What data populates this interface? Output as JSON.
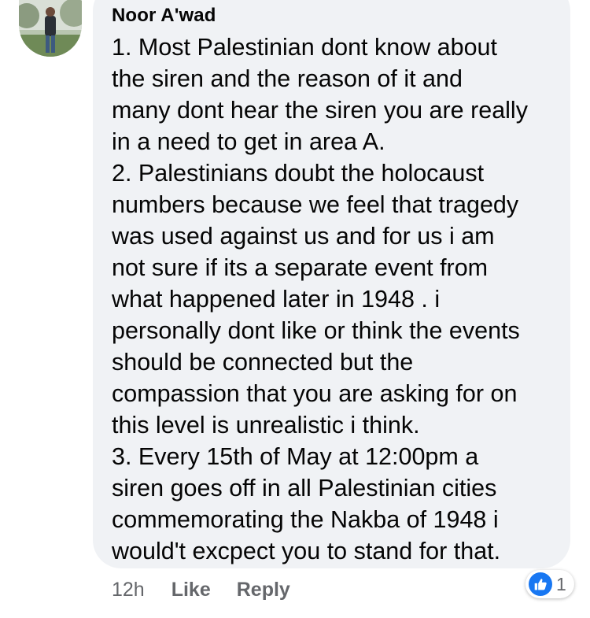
{
  "comment": {
    "author": "Noor A'wad",
    "lines": [
      "1. Most Palestinian dont know about",
      "the siren and the reason of it and",
      "many dont hear the siren you are really",
      "in a need to get in area A.",
      "2. Palestinians doubt the holocaust",
      "numbers because we feel that tragedy",
      "was used against us and for us i am",
      "not sure if its a separate event from",
      "what happened later in 1948 . i",
      "personally dont like or think the events",
      "should be connected but the",
      "compassion that you are asking for on",
      "this level is unrealistic i think.",
      "3. Every 15th of May at 12:00pm a",
      "siren goes off in all Palestinian cities",
      "commemorating the Nakba of 1948 i",
      "would't excpect you to stand for that."
    ]
  },
  "actions": {
    "timestamp": "12h",
    "like_label": "Like",
    "reply_label": "Reply"
  },
  "reactions": {
    "icon": "thumbs-up-icon",
    "count": "1",
    "color": "#1877f2"
  },
  "colors": {
    "bubble": "#f0f2f5",
    "text": "#050505",
    "secondary": "#65676b"
  }
}
